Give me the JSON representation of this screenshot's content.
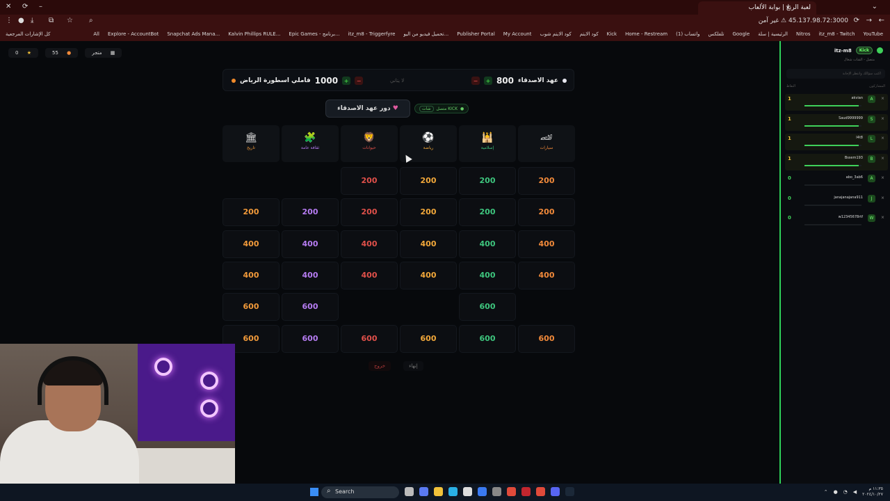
{
  "browser": {
    "tab_title": "لعبة الربع | بوابة الألعاب",
    "url": "45.137.98.72:3000",
    "security": "غير آمن",
    "bookmarks": [
      "YouTube",
      "itz_m8 - Twitch",
      "Nitros",
      "الرئيسية | سلة",
      "Google",
      "تلفلكس",
      "(1) واتساب",
      "Home - Restream",
      "Kick",
      "كود الايتم",
      "كود الايتم شوب",
      "My Account",
      "Publisher Portal",
      "تحميل فيديو من اليو...",
      "itz_m8 - Triggerfyre",
      "Epic Games - برنامج...",
      "Kalvin Phillips RULE...",
      "Snapchat Ads Mana...",
      "Explore - AccountBot",
      "All"
    ],
    "bookmarks_left": "كل الإشارات المرجعية"
  },
  "top_left": {
    "coins": "0",
    "stars": "55",
    "store": "متجر"
  },
  "scoreboard": {
    "team_a": {
      "name": "عهد الاصدقاء",
      "score": "800",
      "dot": "#e8e8f0"
    },
    "team_b": {
      "name": "فاملي اسطورة الرياض",
      "score": "1000",
      "dot": "#f08a2a"
    },
    "turn_label": "لا يتاني"
  },
  "turn_button": "دور عهد الاصدقاء",
  "kick_status": {
    "label": "متصل KICK",
    "chat": "شات"
  },
  "categories": [
    {
      "name": "تاريخ",
      "icon": "🏛",
      "color": "#f29a3a"
    },
    {
      "name": "ثقافة عامة",
      "icon": "🧩",
      "color": "#b67cf2"
    },
    {
      "name": "حيوانات",
      "icon": "🦁",
      "color": "#e0504a"
    },
    {
      "name": "رياضة",
      "icon": "⚽",
      "color": "#f2a83a"
    },
    {
      "name": "إسلامية",
      "icon": "🕌",
      "color": "#3ec67e"
    },
    {
      "name": "سيارات",
      "icon": "🏎",
      "color": "#f28a3a"
    }
  ],
  "board": [
    [
      "",
      "",
      "200",
      "200",
      "200",
      "200"
    ],
    [
      "200",
      "200",
      "200",
      "200",
      "200",
      "200"
    ],
    [
      "400",
      "400",
      "400",
      "400",
      "400",
      "400"
    ],
    [
      "400",
      "400",
      "400",
      "400",
      "400",
      "400"
    ],
    [
      "600",
      "600",
      "",
      "",
      "600",
      ""
    ],
    [
      "600",
      "600",
      "600",
      "600",
      "600",
      "600"
    ]
  ],
  "buttons": {
    "exit": "خروج",
    "end": "إنهاء"
  },
  "sidebar": {
    "user": "itz-m8",
    "platform": "Kick",
    "status": "متصل - الشات شغال",
    "hint": "اكتب سؤالك وانتظر الإجابة",
    "col_points": "النقاط",
    "col_players": "المشاركون",
    "players": [
      {
        "name": "akvian",
        "points": "1",
        "initial": "A",
        "progress": 0.95
      },
      {
        "name": "Saud9999999",
        "points": "1",
        "initial": "S",
        "progress": 0.95
      },
      {
        "name": "l4t8",
        "points": "1",
        "initial": "L",
        "progress": 0.95
      },
      {
        "name": "Bssem193",
        "points": "1",
        "initial": "B",
        "progress": 0.95
      },
      {
        "name": "abo_3ab6",
        "points": "0",
        "initial": "A",
        "progress": 0
      },
      {
        "name": "janajanajana911",
        "points": "0",
        "initial": "J",
        "progress": 0
      },
      {
        "name": "w12345678rtf",
        "points": "0",
        "initial": "W",
        "progress": 0
      }
    ]
  },
  "taskbar": {
    "search": "Search",
    "time": "١١:٣٥ م",
    "date": "٢٠٢٤/١٠/٢٧"
  }
}
